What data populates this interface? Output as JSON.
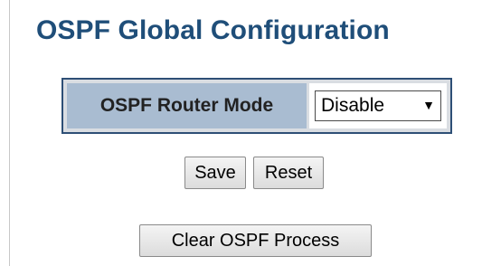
{
  "page": {
    "title": "OSPF Global Configuration"
  },
  "config": {
    "router_mode_label": "OSPF Router Mode",
    "router_mode_value": "Disable",
    "router_mode_arrow": "▼"
  },
  "buttons": {
    "save_label": "Save",
    "reset_label": "Reset",
    "clear_process_label": "Clear OSPF Process"
  },
  "colors": {
    "title": "#1f4e79",
    "table_border": "#2e4f76",
    "label_cell_bg": "#a9bcd1"
  }
}
